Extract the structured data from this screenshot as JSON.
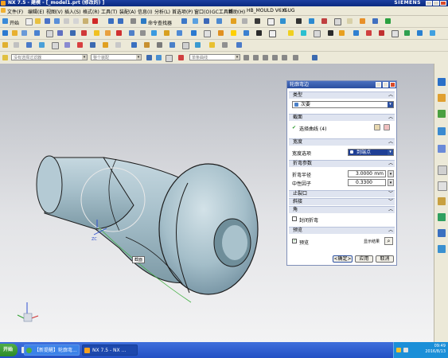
{
  "window": {
    "title": "NX 7.5 - 建模 - [_model1.prt (修改的) ]",
    "brand": "SIEMENS"
  },
  "menu": [
    "文件(F)",
    "编辑(E)",
    "视图(V)",
    "插入(S)",
    "格式(R)",
    "工具(T)",
    "装配(A)",
    "信息(I)",
    "分析(L)",
    "首选项(P)",
    "窗口(O)",
    "GC工具箱",
    "帮助(H)",
    "HB_MOULD V6.6",
    "YSUG"
  ],
  "toolbar": {
    "start_label": "开始",
    "command_finder": "命令查找器",
    "selection_filter": "没有选择过滤器",
    "scope": "整个装配",
    "snap_label": "单条曲线"
  },
  "dialog": {
    "title": "轮廓弯边",
    "type_section": "类型",
    "type_value": "次要",
    "section_section": "截面",
    "select_curve": "选择曲线 (4)",
    "width_section": "宽度",
    "width_option_label": "宽度选项",
    "width_option_value": "到端点",
    "bend_section": "折弯参数",
    "bend_radius_label": "折弯半径",
    "bend_radius_value": "3.0000",
    "bend_radius_unit": "mm",
    "neutral_factor_label": "中性因子",
    "neutral_factor_value": "0.3300",
    "relief_section": "止裂口",
    "miter_section": "斜接",
    "corner_section": "角",
    "close_corner_label": "封闭折弯",
    "preview_section": "预览",
    "preview_check_label": "预览",
    "show_result_label": "显示结果",
    "ok": "<确定>",
    "apply": "应用",
    "cancel": "取消"
  },
  "viewport": {
    "label_zc": "ZC",
    "section_tag": "截面"
  },
  "taskbar": {
    "start": "开始",
    "task1": "【新提醒】轮廓弯...",
    "task2": "NX 7.5 - NX ...",
    "time": "09:49",
    "date": "2016/8/13"
  },
  "colors": {
    "titlebar": "#1c3fa0",
    "dialog_title": "#2b4f9f",
    "part_body": "#9fb8c4",
    "taskbar": "#2350c4",
    "start_green": "#3c9a35"
  }
}
